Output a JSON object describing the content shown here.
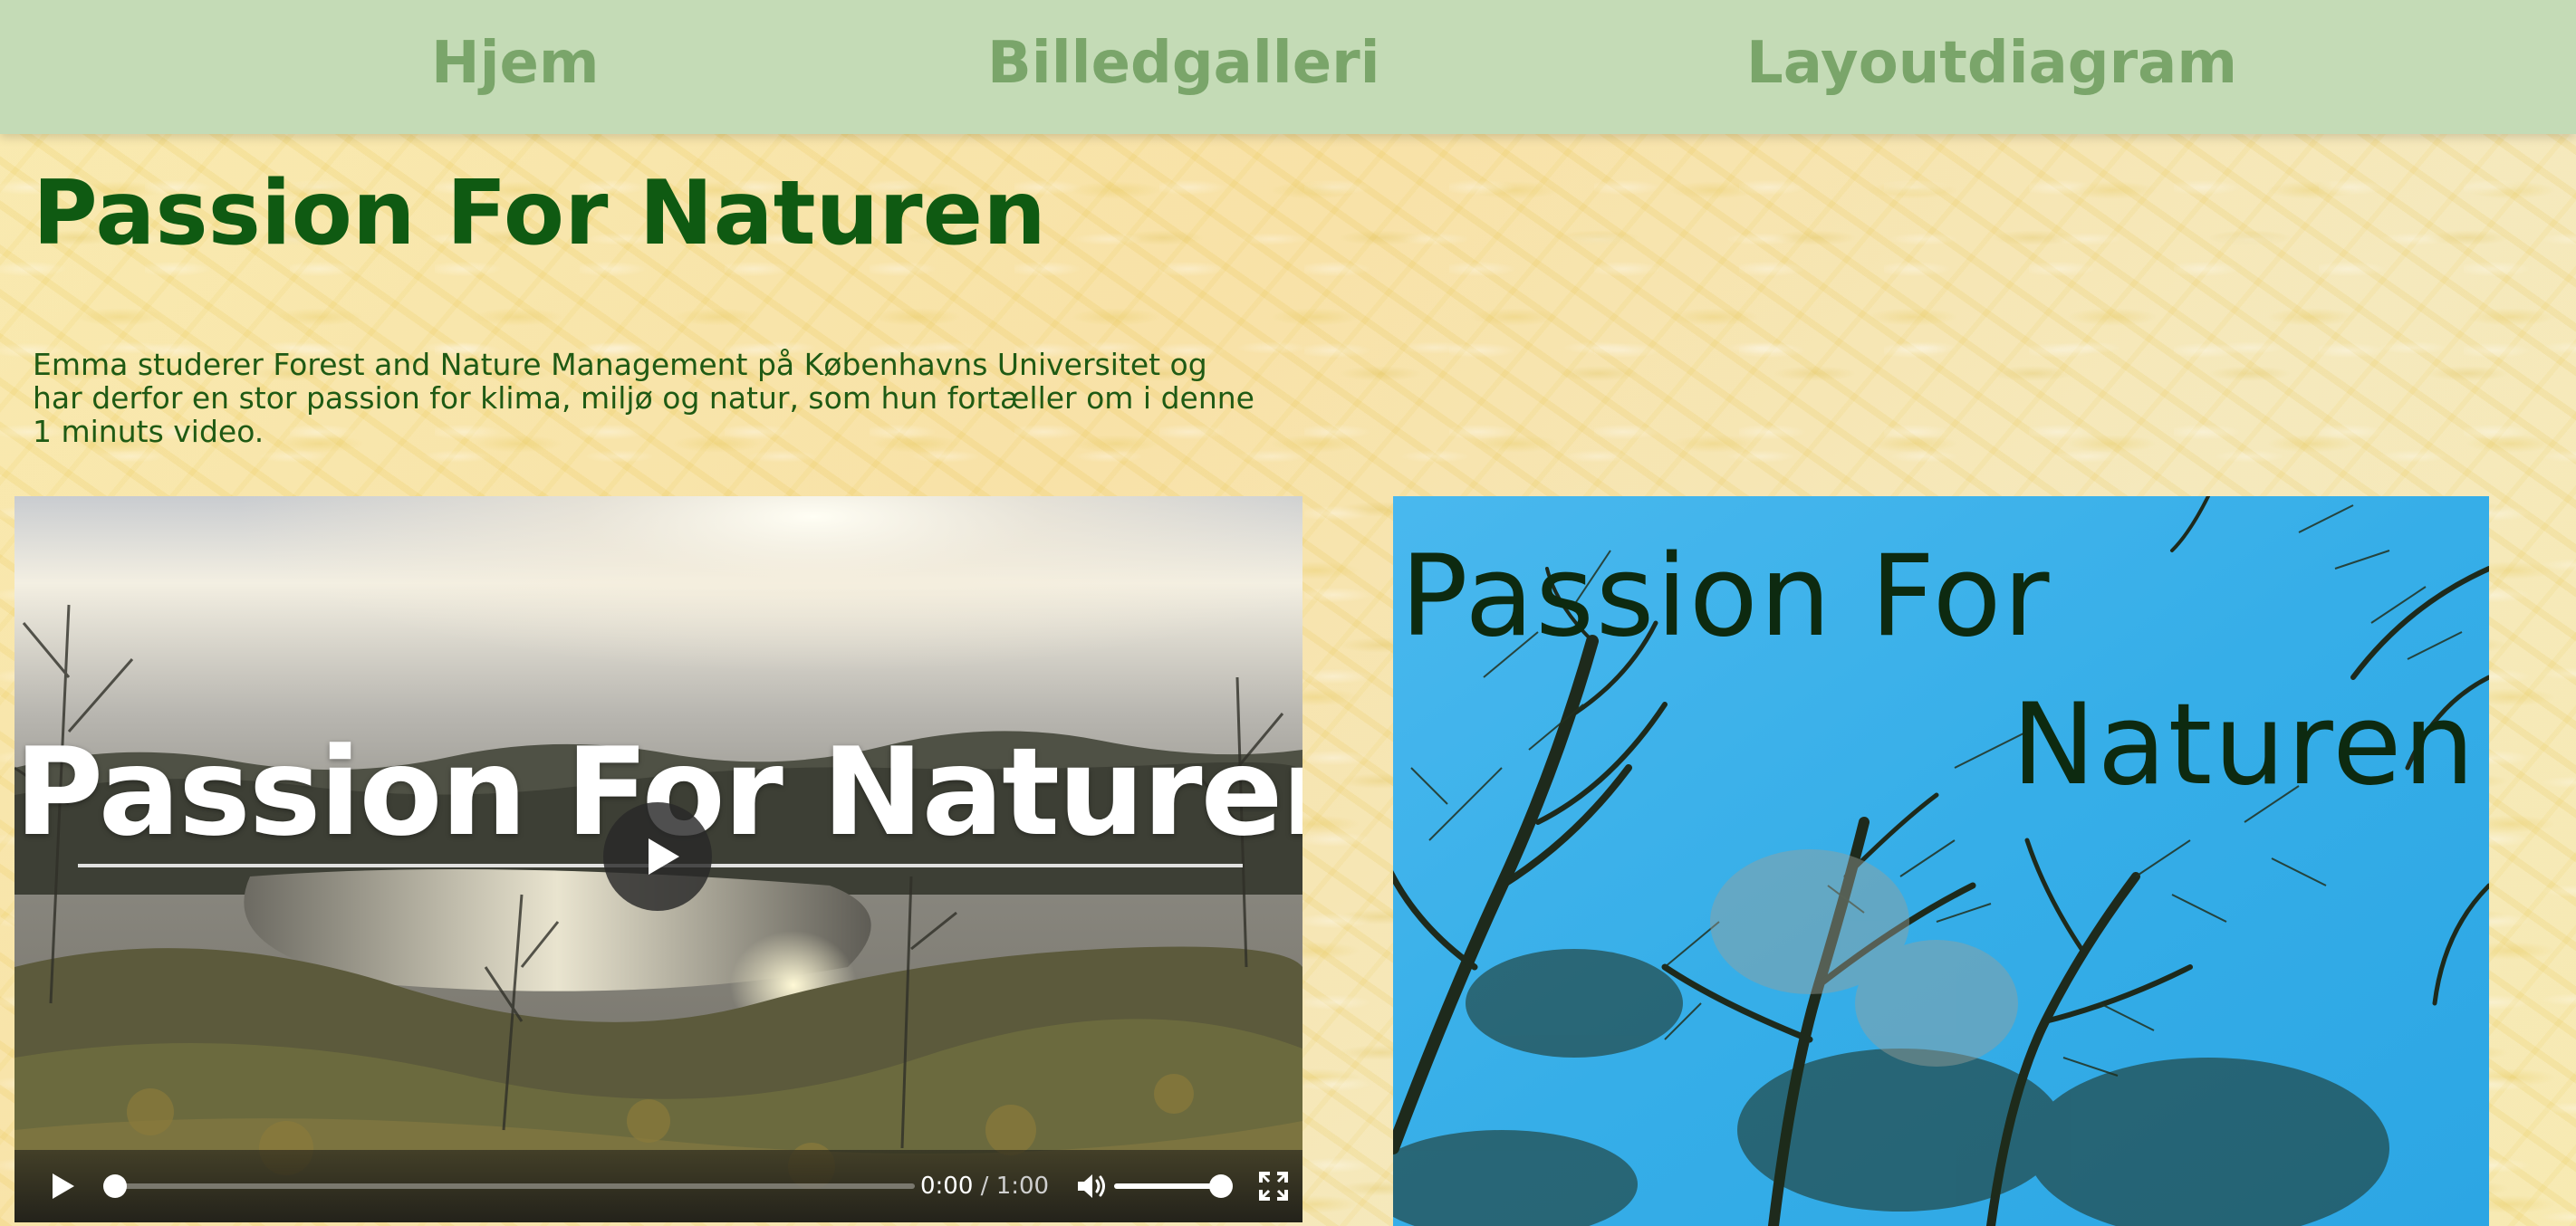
{
  "nav": {
    "items": [
      {
        "label": "Hjem"
      },
      {
        "label": "Billedgalleri"
      },
      {
        "label": "Layoutdiagram"
      }
    ]
  },
  "page": {
    "title": "Passion For Naturen",
    "intro": "Emma studerer Forest and Nature Management på Københavns Universitet og har derfor en stor passion for klima, miljø og natur, som hun fortæller om i denne 1 minuts video."
  },
  "video": {
    "overlay_title": "Passion For Naturen",
    "current_time": "0:00",
    "separator": " / ",
    "duration": "1:00",
    "progress": 0,
    "volume": 1,
    "icons": {
      "big_play": "play-icon",
      "play": "play-icon",
      "volume": "volume-icon",
      "fullscreen": "fullscreen-icon"
    }
  },
  "poster": {
    "line1": "Passion For",
    "line2": "Naturen"
  },
  "colors": {
    "nav_bg": "#c4dbb6",
    "nav_text": "#7aa56a",
    "title": "#0f5a12",
    "intro": "#1f5a14",
    "poster_text": "#0d2a10",
    "sky": "#3cb4ec"
  }
}
